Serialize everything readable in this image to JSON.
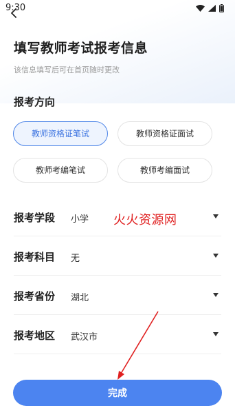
{
  "status_bar": {
    "time": "9:30"
  },
  "header": {
    "title": "填写教师考试报考信息",
    "subtitle": "该信息填写后可在首页随时更改"
  },
  "direction": {
    "title": "报考方向",
    "options": [
      {
        "label": "教师资格证笔试",
        "selected": true
      },
      {
        "label": "教师资格证面试",
        "selected": false
      },
      {
        "label": "教师考编笔试",
        "selected": false
      },
      {
        "label": "教师考编面试",
        "selected": false
      }
    ]
  },
  "form": {
    "rows": [
      {
        "label": "报考学段",
        "value": "小学"
      },
      {
        "label": "报考科目",
        "value": "无"
      },
      {
        "label": "报考省份",
        "value": "湖北"
      },
      {
        "label": "报考地区",
        "value": "武汉市"
      }
    ]
  },
  "watermark": "火火资源网",
  "actions": {
    "finish_label": "完成"
  },
  "colors": {
    "accent": "#4c84f0",
    "watermark": "#e02020"
  }
}
